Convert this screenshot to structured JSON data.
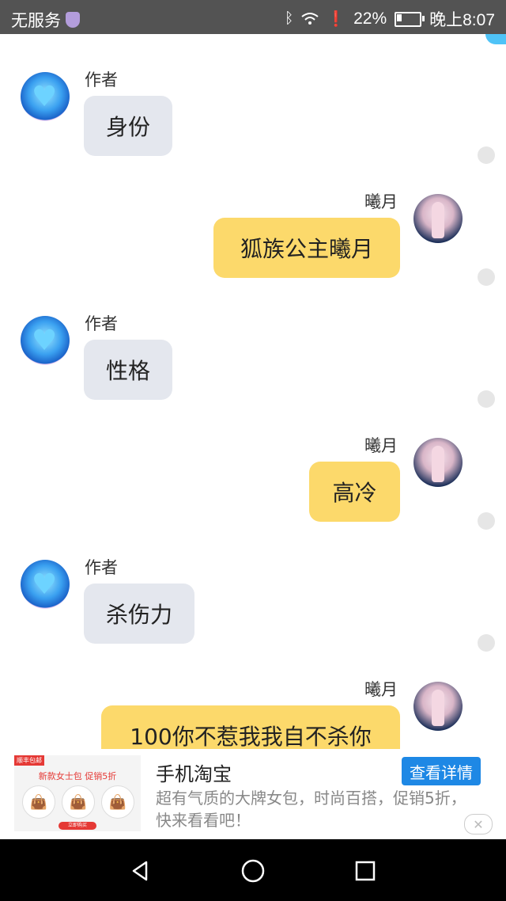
{
  "status_bar": {
    "carrier": "无服务",
    "battery": "22%",
    "time": "晚上8:07",
    "icons": [
      "shield-icon",
      "bluetooth-icon",
      "wifi-icon",
      "alert-icon",
      "battery-icon"
    ]
  },
  "messages": [
    {
      "sender": "作者",
      "text": "身份",
      "side": "left"
    },
    {
      "sender": "曦月",
      "text": "狐族公主曦月",
      "side": "right"
    },
    {
      "sender": "作者",
      "text": "性格",
      "side": "left"
    },
    {
      "sender": "曦月",
      "text": "高冷",
      "side": "right"
    },
    {
      "sender": "作者",
      "text": "杀伤力",
      "side": "left"
    },
    {
      "sender": "曦月",
      "text": "100你不惹我我自不杀你",
      "side": "right"
    }
  ],
  "ad": {
    "tag": "顺丰包邮",
    "promo": "新款女士包 促销5折",
    "buy_label": "立即购买",
    "title": "手机淘宝",
    "description": "超有气质的大牌女包，时尚百搭，促销5折，快来看看吧！",
    "button": "查看详情",
    "close_icon": "close-icon"
  },
  "colors": {
    "left_bubble": "#e4e7ee",
    "right_bubble": "#fcd96b",
    "ad_button": "#1e88e5",
    "status_bar": "#535353"
  },
  "nav": [
    "back-icon",
    "home-icon",
    "recents-icon"
  ]
}
